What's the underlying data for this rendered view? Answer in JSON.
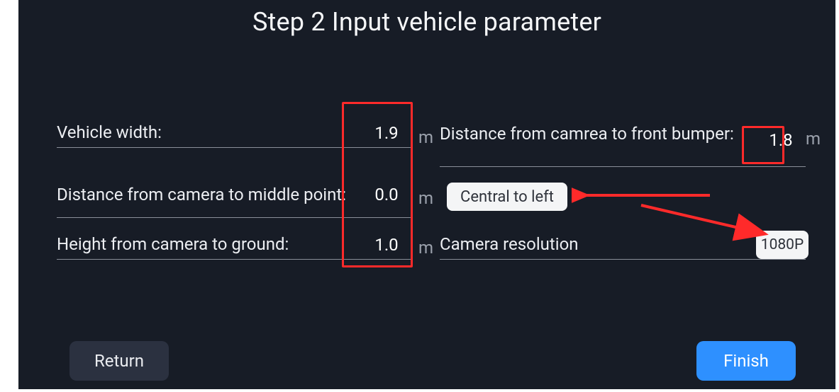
{
  "title": "Step 2 Input vehicle parameter",
  "left": {
    "width_label": "Vehicle width:",
    "width_value": "1.9",
    "mid_label": "Distance from camera to middle point:",
    "mid_value": "0.0",
    "height_label": "Height from camera to ground:",
    "height_value": "1.0"
  },
  "right": {
    "bumper_label": "Distance from camrea to front bumper:",
    "bumper_value": "1.8",
    "side_selector": "Central to left",
    "res_label": "Camera resolution",
    "res_value": "1080P"
  },
  "unit": "m",
  "buttons": {
    "return": "Return",
    "finish": "Finish"
  }
}
